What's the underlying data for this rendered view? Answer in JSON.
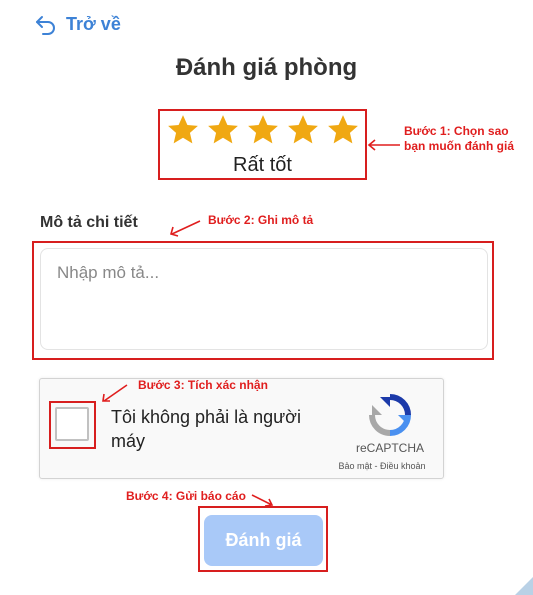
{
  "nav": {
    "back_label": "Trở về"
  },
  "page": {
    "title": "Đánh giá phòng"
  },
  "rating": {
    "value": 5,
    "max": 5,
    "label": "Rất tốt",
    "star_color": "#f0a812"
  },
  "detail": {
    "label": "Mô tả chi tiết",
    "placeholder": "Nhập mô tả...",
    "value": ""
  },
  "captcha": {
    "checkbox_label": "Tôi không phải là người máy",
    "brand": "reCAPTCHA",
    "links": "Bảo mật - Điều khoản"
  },
  "submit": {
    "label": "Đánh giá",
    "color": "#a9c9f8"
  },
  "annotations": {
    "step1_line1": "Bước 1: Chọn sao",
    "step1_line2": "bạn  muốn đánh giá",
    "step2": "Bước 2: Ghi mô tả",
    "step3": "Bước 3: Tích xác nhận",
    "step4": "Bước 4: Gửi báo cáo",
    "color": "#e01e1e"
  }
}
